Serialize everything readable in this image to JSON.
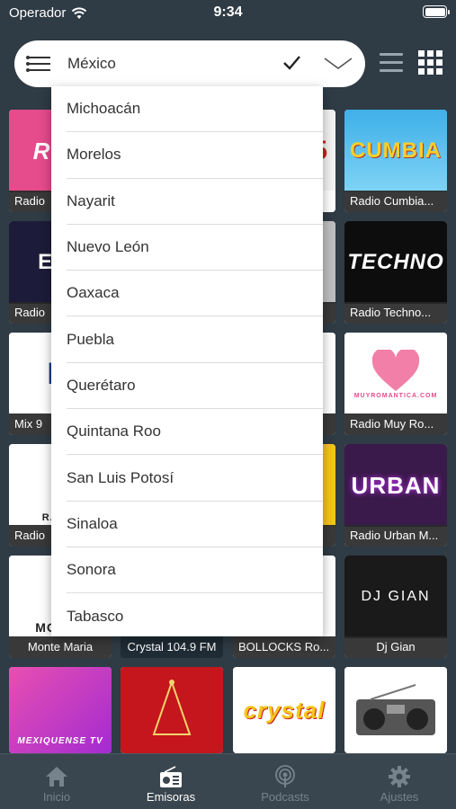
{
  "status_bar": {
    "carrier": "Operador",
    "time": "9:34"
  },
  "selector": {
    "selected": "México"
  },
  "dropdown": {
    "items": [
      "Michoacán",
      "Morelos",
      "Nayarit",
      "Nuevo León",
      "Oaxaca",
      "Puebla",
      "Querétaro",
      "Quintana Roo",
      "San Luis Potosí",
      "Sinaloa",
      "Sonora",
      "Tabasco"
    ]
  },
  "stations": [
    {
      "caption": "Radio",
      "art": "Rom"
    },
    {
      "caption": "Radio Cumbia...",
      "art": "CUMBIA"
    },
    {
      "caption": "Radio",
      "art": "ELE"
    },
    {
      "caption": "Radio Techno...",
      "art": "TECHNO"
    },
    {
      "caption": "Mix 9",
      "art": "M"
    },
    {
      "caption": "Radio Muy Ro...",
      "art": "MUYROMANTICA.COM"
    },
    {
      "caption": "Radio",
      "art": "RADIO"
    },
    {
      "caption": "Radio Urban M...",
      "art": "URBAN"
    },
    {
      "caption": "Monte Maria",
      "art": "MONTE"
    },
    {
      "caption": "Crystal 104.9 FM",
      "art": ""
    },
    {
      "caption": "BOLLOCKS Ro...",
      "art": ""
    },
    {
      "caption": "Dj Gian",
      "art": "DJ GIAN"
    },
    {
      "caption": "",
      "art": "MEXIQUENSE TV"
    },
    {
      "caption": "",
      "art": ""
    },
    {
      "caption": "",
      "art": "crystal"
    },
    {
      "caption": "",
      "art": ""
    }
  ],
  "tabs": [
    {
      "label": "Inicio",
      "icon": "home-icon"
    },
    {
      "label": "Emisoras",
      "icon": "radio-icon"
    },
    {
      "label": "Podcasts",
      "icon": "podcast-icon"
    },
    {
      "label": "Ajustes",
      "icon": "gear-icon"
    }
  ],
  "colors": {
    "background": "#2f3b45",
    "tabbar": "#39464f",
    "tab_active": "#ffffff",
    "tab_inactive": "#76838d"
  }
}
